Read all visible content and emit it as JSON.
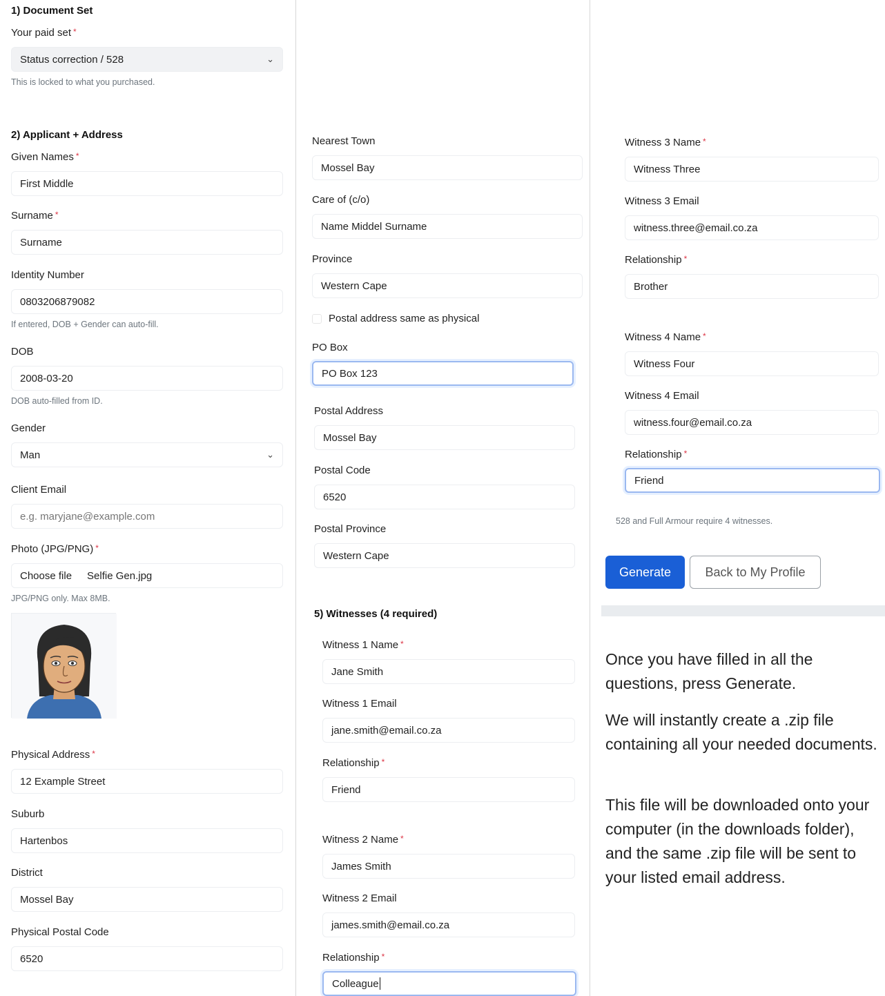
{
  "section1": {
    "title": "1) Document Set",
    "paid_set_label": "Your paid set",
    "paid_set_value": "Status correction / 528",
    "help": "This is locked to what you purchased."
  },
  "section2": {
    "title": "2) Applicant + Address",
    "given_names_label": "Given Names",
    "given_names_value": "First Middle",
    "surname_label": "Surname",
    "surname_value": "Surname",
    "id_label": "Identity Number",
    "id_value": "0803206879082",
    "id_help": "If entered, DOB + Gender can auto-fill.",
    "dob_label": "DOB",
    "dob_value": "2008-03-20",
    "dob_help": "DOB auto-filled from ID.",
    "gender_label": "Gender",
    "gender_value": "Man",
    "email_label": "Client Email",
    "email_placeholder": "e.g. maryjane@example.com",
    "photo_label": "Photo (JPG/PNG)",
    "photo_button": "Choose file",
    "photo_filename": "Selfie Gen.jpg",
    "photo_help": "JPG/PNG only. Max 8MB.",
    "phys_addr_label": "Physical Address",
    "phys_addr_value": "12 Example Street",
    "suburb_label": "Suburb",
    "suburb_value": "Hartenbos",
    "district_label": "District",
    "district_value": "Mossel Bay",
    "phys_postal_label": "Physical Postal Code",
    "phys_postal_value": "6520"
  },
  "address": {
    "nearest_town_label": "Nearest Town",
    "nearest_town_value": "Mossel Bay",
    "care_of_label": "Care of (c/o)",
    "care_of_value": "Name Middel Surname",
    "province_label": "Province",
    "province_value": "Western Cape",
    "same_postal_label": "Postal address same as physical",
    "po_box_label": "PO Box",
    "po_box_value": "PO Box 123",
    "postal_addr_label": "Postal Address",
    "postal_addr_value": "Mossel Bay",
    "postal_code_label": "Postal Code",
    "postal_code_value": "6520",
    "postal_province_label": "Postal Province",
    "postal_province_value": "Western Cape"
  },
  "witnesses": {
    "title": "5) Witnesses (4 required)",
    "w1_name_label": "Witness 1 Name",
    "w1_name_value": "Jane Smith",
    "w1_email_label": "Witness 1 Email",
    "w1_email_value": "jane.smith@email.co.za",
    "w1_rel_label": "Relationship",
    "w1_rel_value": "Friend",
    "w2_name_label": "Witness 2 Name",
    "w2_name_value": "James Smith",
    "w2_email_label": "Witness 2 Email",
    "w2_email_value": "james.smith@email.co.za",
    "w2_rel_label": "Relationship",
    "w2_rel_value": "Colleague",
    "w3_name_label": "Witness 3 Name",
    "w3_name_value": "Witness Three",
    "w3_email_label": "Witness 3 Email",
    "w3_email_value": "witness.three@email.co.za",
    "w3_rel_label": "Relationship",
    "w3_rel_value": "Brother",
    "w4_name_label": "Witness 4 Name",
    "w4_name_value": "Witness Four",
    "w4_email_label": "Witness 4 Email",
    "w4_email_value": "witness.four@email.co.za",
    "w4_rel_label": "Relationship",
    "w4_rel_value": "Friend",
    "note": "528 and Full Armour require 4 witnesses."
  },
  "actions": {
    "generate": "Generate",
    "back": "Back to My Profile"
  },
  "info": {
    "p1": "Once you have filled in all the questions, press Generate.",
    "p2": "We will instantly create a .zip file containing all your needed documents.",
    "p3": "This file will be downloaded onto your computer (in the downloads folder), and the same .zip file will be sent to your listed email address."
  },
  "required_marker": "*",
  "dropdown_glyph": "⌄",
  "colors": {
    "primary": "#1a5fd6",
    "required": "#dc3545",
    "focus_ring": "#9ab8f0"
  }
}
